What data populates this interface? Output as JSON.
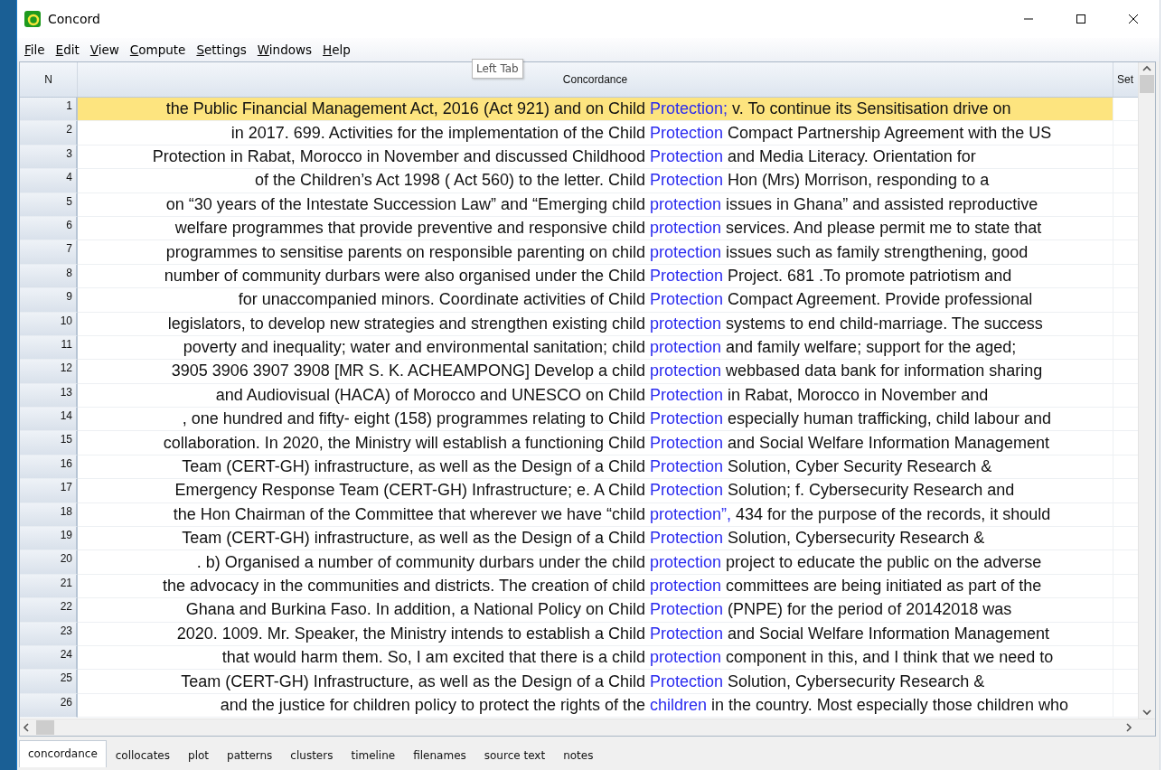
{
  "window": {
    "title": "Concord"
  },
  "menu": [
    "File",
    "Edit",
    "View",
    "Compute",
    "Settings",
    "Windows",
    "Help"
  ],
  "tooltip": "Left Tab",
  "table": {
    "columns": [
      "N",
      "Concordance",
      "Set"
    ],
    "rows": [
      {
        "n": "1",
        "left": "the Public Financial Management Act, 2016 (Act 921) and on Child",
        "keyword": "Protection;",
        "right": "v. To continue its Sensitisation drive on",
        "selected": true
      },
      {
        "n": "2",
        "left": "in 2017. 699. Activities for the implementation of the Child",
        "keyword": "Protection",
        "right": "Compact Partnership Agreement with the US",
        "selected": false
      },
      {
        "n": "3",
        "left": "Protection in Rabat, Morocco in November and discussed Childhood",
        "keyword": "Protection",
        "right": "and Media Literacy. Orientation for",
        "selected": false
      },
      {
        "n": "4",
        "left": "of the Children’s Act 1998 ( Act 560) to the letter. Child",
        "keyword": "Protection",
        "right": "Hon (Mrs) Morrison, responding to a",
        "selected": false
      },
      {
        "n": "5",
        "left": "on “30 years of the Intestate Succession Law” and “Emerging child",
        "keyword": "protection",
        "right": "issues in Ghana” and assisted reproductive",
        "selected": false
      },
      {
        "n": "6",
        "left": "welfare programmes that provide preventive and responsive child",
        "keyword": "protection",
        "right": "services. And please permit me to state that",
        "selected": false
      },
      {
        "n": "7",
        "left": "programmes to sensitise parents on responsible parenting on child",
        "keyword": "protection",
        "right": "issues such as family strengthening, good",
        "selected": false
      },
      {
        "n": "8",
        "left": "number of community durbars were also organised under the Child",
        "keyword": "Protection",
        "right": "Project. 681 .To promote patriotism and",
        "selected": false
      },
      {
        "n": "9",
        "left": "for unaccompanied minors. Coordinate activities of Child",
        "keyword": "Protection",
        "right": "Compact Agreement. Provide professional",
        "selected": false
      },
      {
        "n": "10",
        "left": "legislators, to develop new strategies and strengthen existing child",
        "keyword": "protection",
        "right": "systems to end child-marriage. The success",
        "selected": false
      },
      {
        "n": "11",
        "left": "poverty and inequality; water and environmental sanitation; child",
        "keyword": "protection",
        "right": "and family welfare; support for the aged;",
        "selected": false
      },
      {
        "n": "12",
        "left": "3905 3906 3907 3908 [MR S. K. ACHEAMPONG] Develop a child",
        "keyword": "protection",
        "right": "webbased data bank for information sharing",
        "selected": false
      },
      {
        "n": "13",
        "left": "and Audiovisual (HACA) of Morocco and UNESCO on Child",
        "keyword": "Protection",
        "right": "in Rabat, Morocco in November and",
        "selected": false
      },
      {
        "n": "14",
        "left": ", one hundred and fifty- eight (158) programmes relating to Child",
        "keyword": "Protection",
        "right": "especially human trafficking, child labour and",
        "selected": false
      },
      {
        "n": "15",
        "left": "collaboration. In 2020, the Ministry will establish a functioning Child",
        "keyword": "Protection",
        "right": "and Social Welfare Information Management",
        "selected": false
      },
      {
        "n": "16",
        "left": "Team (CERT-GH) infrastructure, as well as the Design of a Child",
        "keyword": "Protection",
        "right": "Solution, Cyber Security Research &",
        "selected": false
      },
      {
        "n": "17",
        "left": "Emergency Response Team (CERT-GH) Infrastructure; e. A Child",
        "keyword": "Protection",
        "right": "Solution; f. Cybersecurity Research and",
        "selected": false
      },
      {
        "n": "18",
        "left": "the Hon Chairman of the Committee that wherever we have “child",
        "keyword": "protection”,",
        "right": "434 for the purpose of the records, it should",
        "selected": false
      },
      {
        "n": "19",
        "left": "Team (CERT-GH) infrastructure, as well as the Design of a Child",
        "keyword": "Protection",
        "right": "Solution, Cybersecurity Research &",
        "selected": false
      },
      {
        "n": "20",
        "left": ". b) Organised a number of community durbars under the child",
        "keyword": "protection",
        "right": "project to educate the public on the adverse",
        "selected": false
      },
      {
        "n": "21",
        "left": "the advocacy in the communities and districts. The creation of child",
        "keyword": "protection",
        "right": "committees are being initiated as part of the",
        "selected": false
      },
      {
        "n": "22",
        "left": "Ghana and Burkina Faso. In addition, a National Policy on Child",
        "keyword": "Protection",
        "right": "(PNPE) for the period of 20142018 was",
        "selected": false
      },
      {
        "n": "23",
        "left": "2020. 1009. Mr. Speaker, the Ministry intends to establish a Child",
        "keyword": "Protection",
        "right": "and Social Welfare Information Management",
        "selected": false
      },
      {
        "n": "24",
        "left": "that would harm them. So, I am excited that there is a child",
        "keyword": "protection",
        "right": "component in this, and I think that we need to",
        "selected": false
      },
      {
        "n": "25",
        "left": "Team (CERT-GH) Infrastructure, as well as the Design of a Child",
        "keyword": "Protection",
        "right": "Solution, Cybersecurity Research &",
        "selected": false
      },
      {
        "n": "26",
        "left": "and the justice for children policy to protect the rights of the",
        "keyword": "children",
        "right": "in the country. Most especially those children who",
        "selected": false
      }
    ]
  },
  "tabs": [
    {
      "label": "concordance",
      "selected": true
    },
    {
      "label": "collocates",
      "selected": false
    },
    {
      "label": "plot",
      "selected": false
    },
    {
      "label": "patterns",
      "selected": false
    },
    {
      "label": "clusters",
      "selected": false
    },
    {
      "label": "timeline",
      "selected": false
    },
    {
      "label": "filenames",
      "selected": false
    },
    {
      "label": "source text",
      "selected": false
    },
    {
      "label": "notes",
      "selected": false
    }
  ]
}
